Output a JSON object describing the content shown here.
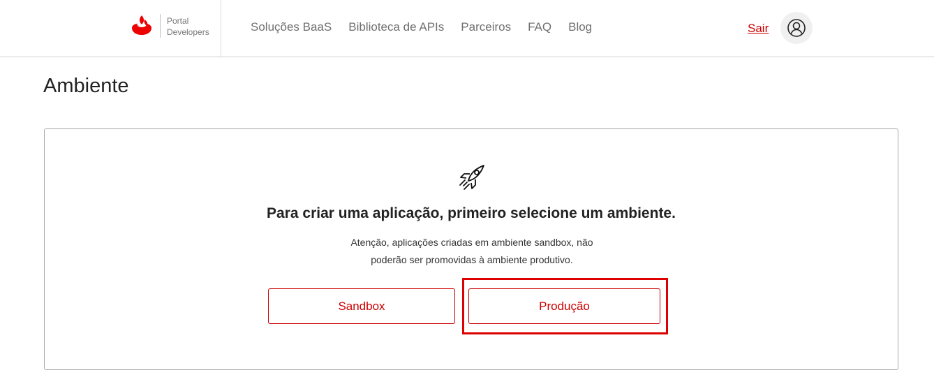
{
  "header": {
    "logo_line1": "Portal",
    "logo_line2": "Developers",
    "nav": [
      "Soluções BaaS",
      "Biblioteca de APIs",
      "Parceiros",
      "FAQ",
      "Blog"
    ],
    "logout_label": "Sair",
    "avatar_icon": "user-circle-icon",
    "brand_color": "#ec0000"
  },
  "main": {
    "title": "Ambiente",
    "card": {
      "icon": "rocket-icon",
      "heading": "Para criar uma aplicação, primeiro selecione um ambiente.",
      "description_line1": "Atenção, aplicações criadas em ambiente sandbox, não",
      "description_line2": "poderão ser promovidas à ambiente produtivo.",
      "buttons": {
        "sandbox": "Sandbox",
        "production": "Produção"
      },
      "highlight_color": "#dd0000"
    }
  }
}
